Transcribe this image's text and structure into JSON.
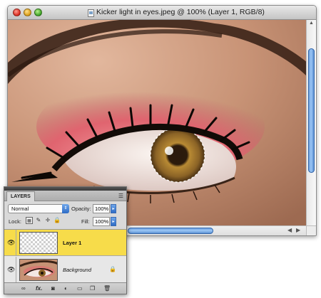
{
  "window": {
    "title": "Kicker light in eyes.jpeg @ 100% (Layer 1, RGB/8)"
  },
  "colors": {
    "skin": "#c69275",
    "eyeshadow": "#e36a72",
    "iris": "#a8782c",
    "selected_layer": "#f7dc4a",
    "scroll_thumb": "#6aa2e4"
  },
  "layers_panel": {
    "tab_label": "LAYERS",
    "blend_mode": "Normal",
    "opacity_label": "Opacity:",
    "opacity_value": "100%",
    "lock_label": "Lock:",
    "fill_label": "Fill:",
    "fill_value": "100%",
    "layers": [
      {
        "name": "Layer 1",
        "selected": true,
        "visible": true,
        "thumbnail": "transparent"
      },
      {
        "name": "Background",
        "selected": false,
        "visible": true,
        "locked": true,
        "thumbnail": "photo"
      }
    ],
    "footer_icons": [
      "link-layers-icon",
      "fx-icon",
      "mask-icon",
      "adjustment-icon",
      "group-icon",
      "new-layer-icon",
      "trash-icon"
    ]
  }
}
